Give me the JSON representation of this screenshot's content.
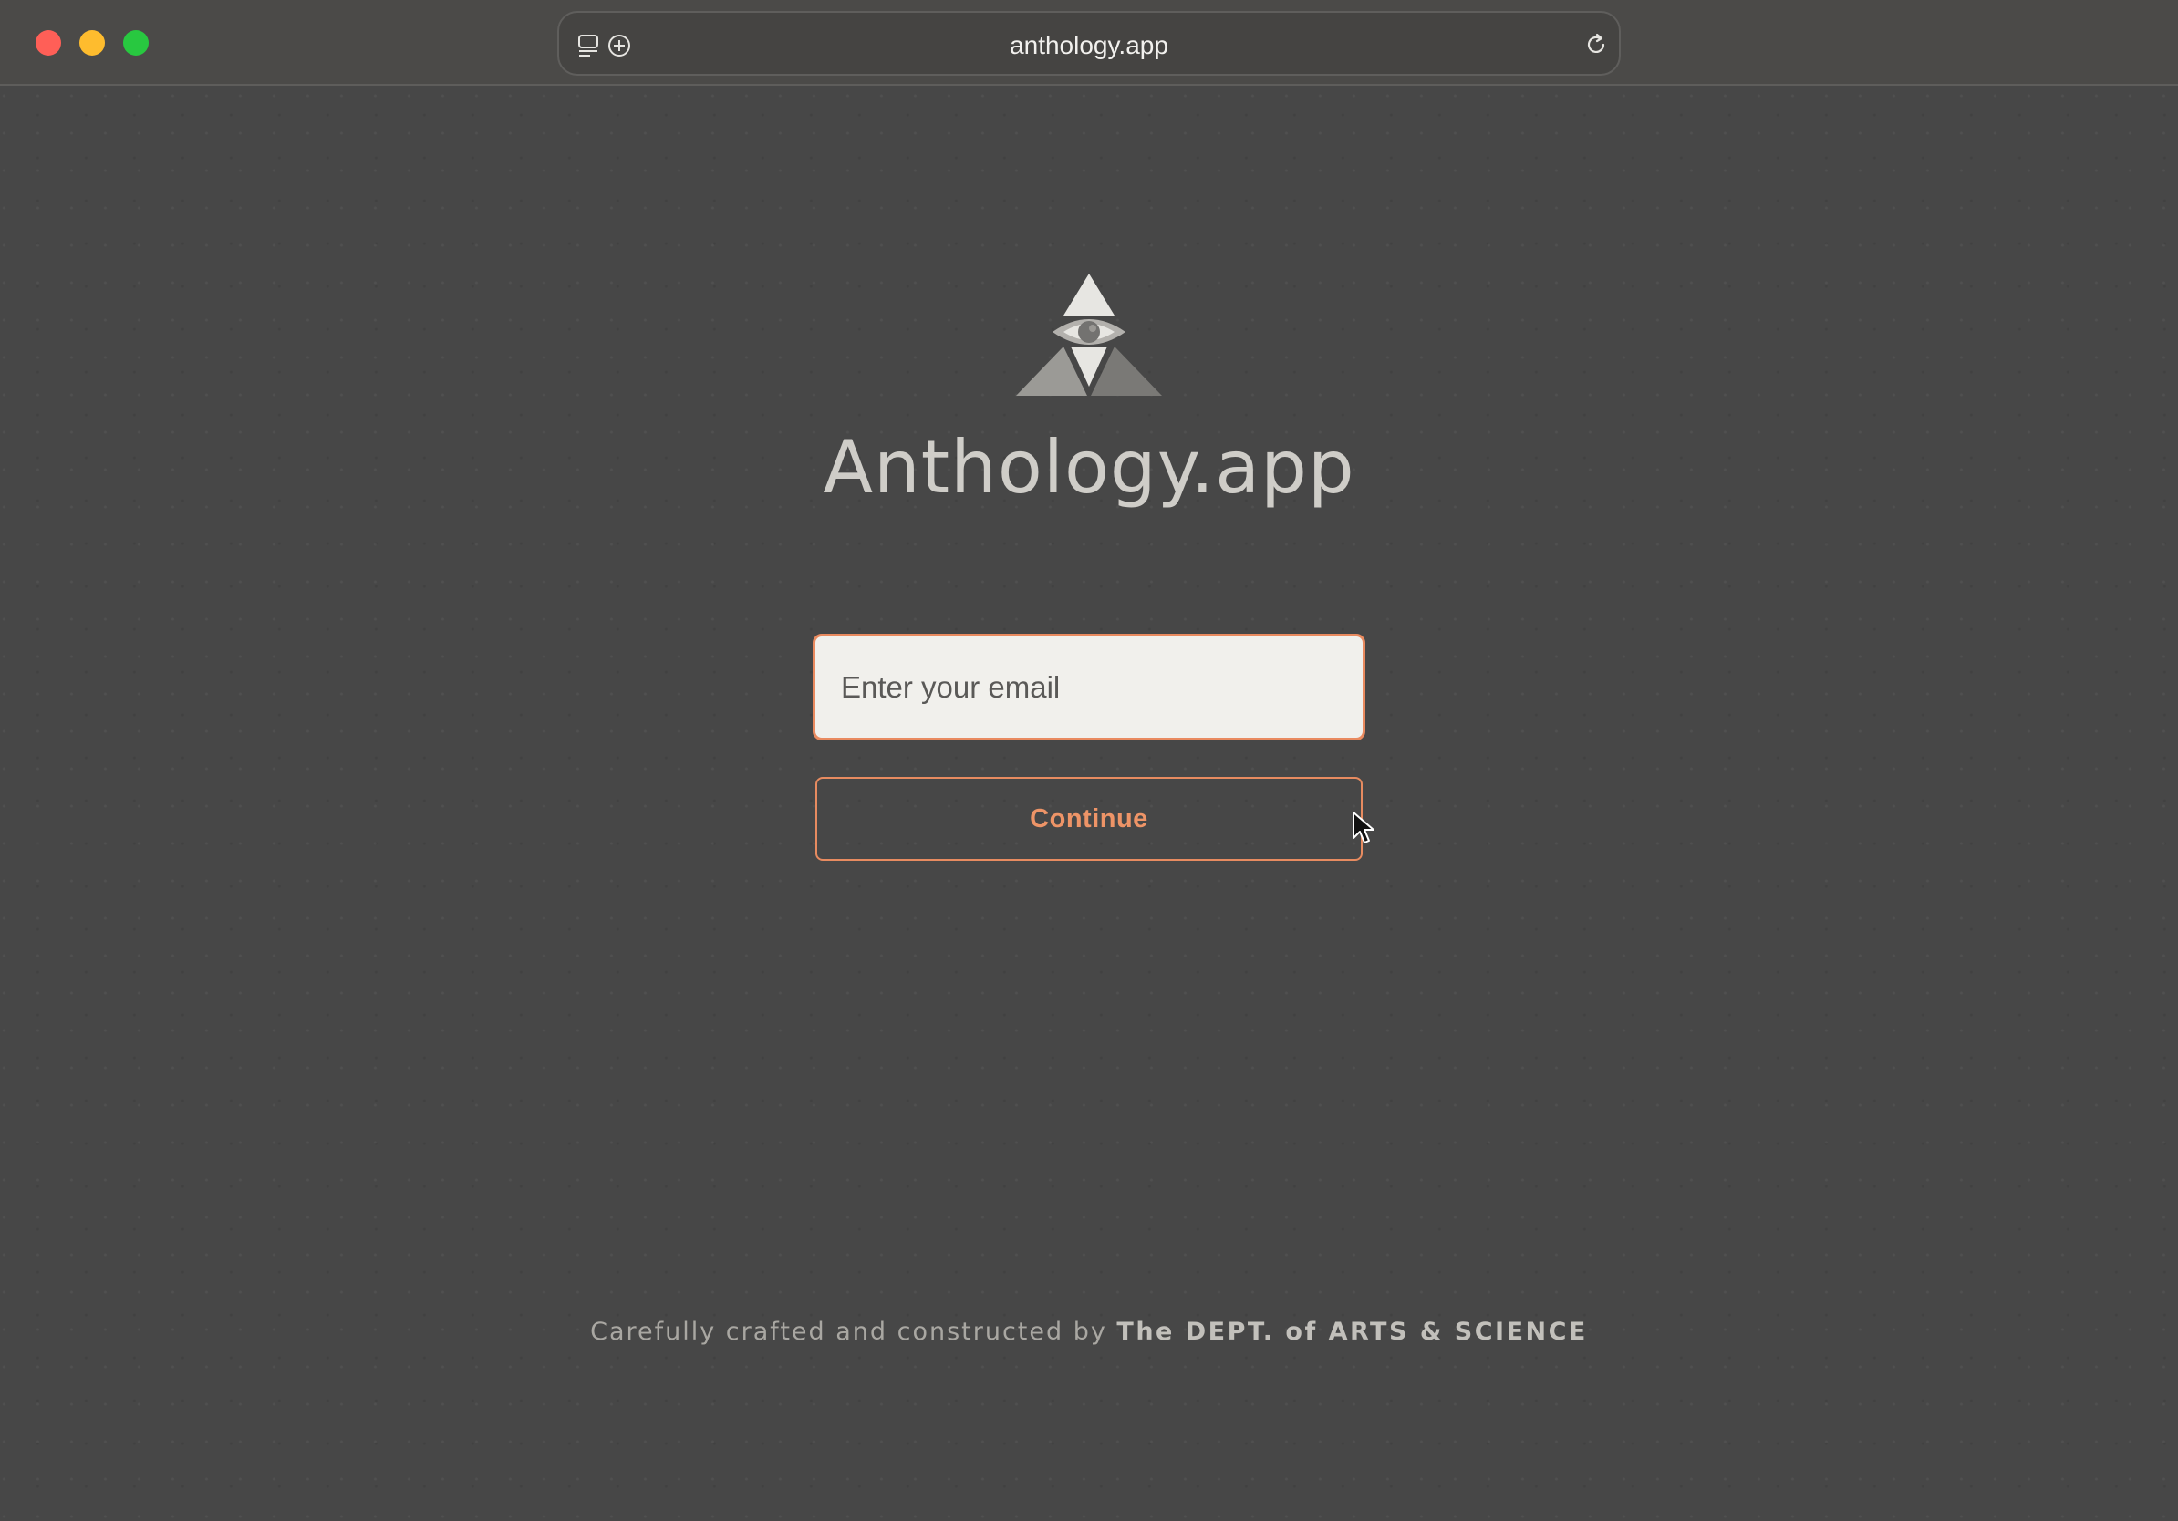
{
  "browser": {
    "url": "anthology.app",
    "icons": {
      "close": "close-dot",
      "minimize": "minimize-dot",
      "zoom": "zoom-dot",
      "sidebar": "sidebar-icon",
      "new_tab": "plus-circle-icon",
      "reload": "reload-icon"
    },
    "colors": {
      "close": "#ff5f57",
      "minimize": "#febc2e",
      "zoom": "#28c840"
    }
  },
  "main": {
    "brand_name": "Anthology.app",
    "logo": "eye-triangle-logo",
    "email": {
      "placeholder": "Enter your email",
      "value": ""
    },
    "continue_label": "Continue"
  },
  "footer": {
    "lead": "Carefully crafted and constructed by ",
    "org": "The DEPT. of ARTS & SCIENCE"
  },
  "colors": {
    "background": "#474747",
    "accent": "#e98a5f",
    "input_bg": "#f1f0ec",
    "title_text": "#cfcdc8"
  }
}
